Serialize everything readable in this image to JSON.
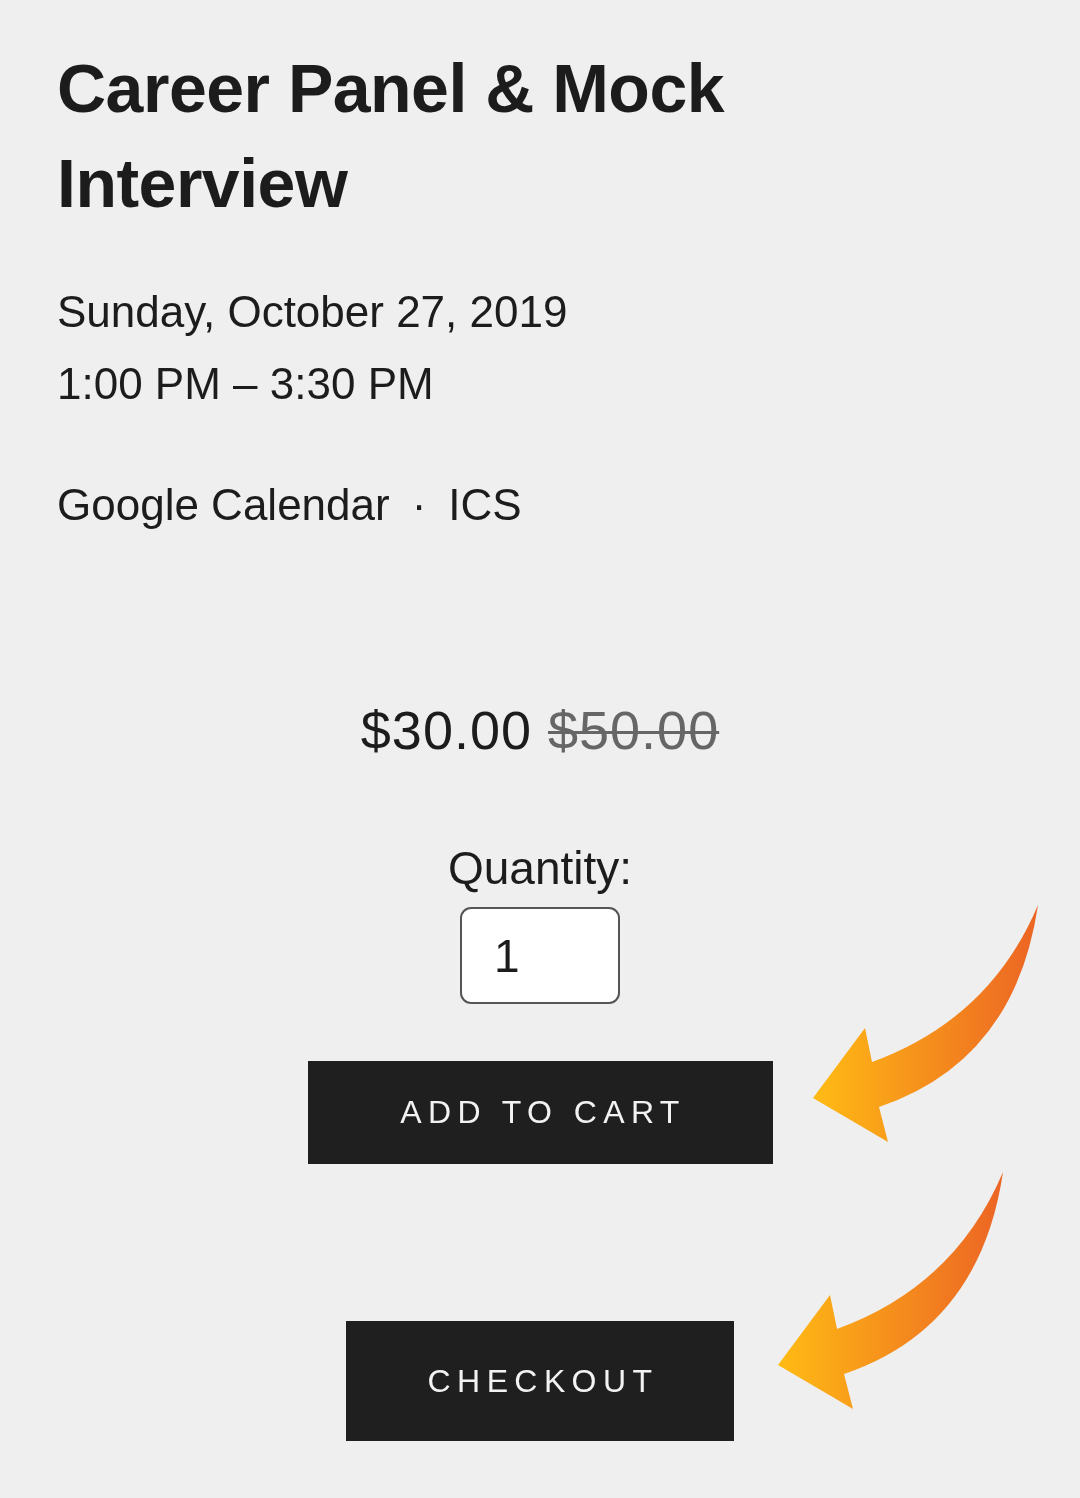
{
  "event": {
    "title": "Career Panel & Mock Interview",
    "date": "Sunday, October 27, 2019",
    "time": "1:00 PM – 3:30 PM",
    "calendar_links": [
      {
        "label": "Google Calendar"
      },
      {
        "label": "ICS"
      }
    ],
    "link_separator": "·"
  },
  "price": {
    "current": "$30.00",
    "original": "$50.00"
  },
  "quantity": {
    "label": "Quantity:",
    "value": "1"
  },
  "buttons": [
    {
      "label": "ADD TO CART"
    },
    {
      "label": "CHECKOUT"
    }
  ]
}
